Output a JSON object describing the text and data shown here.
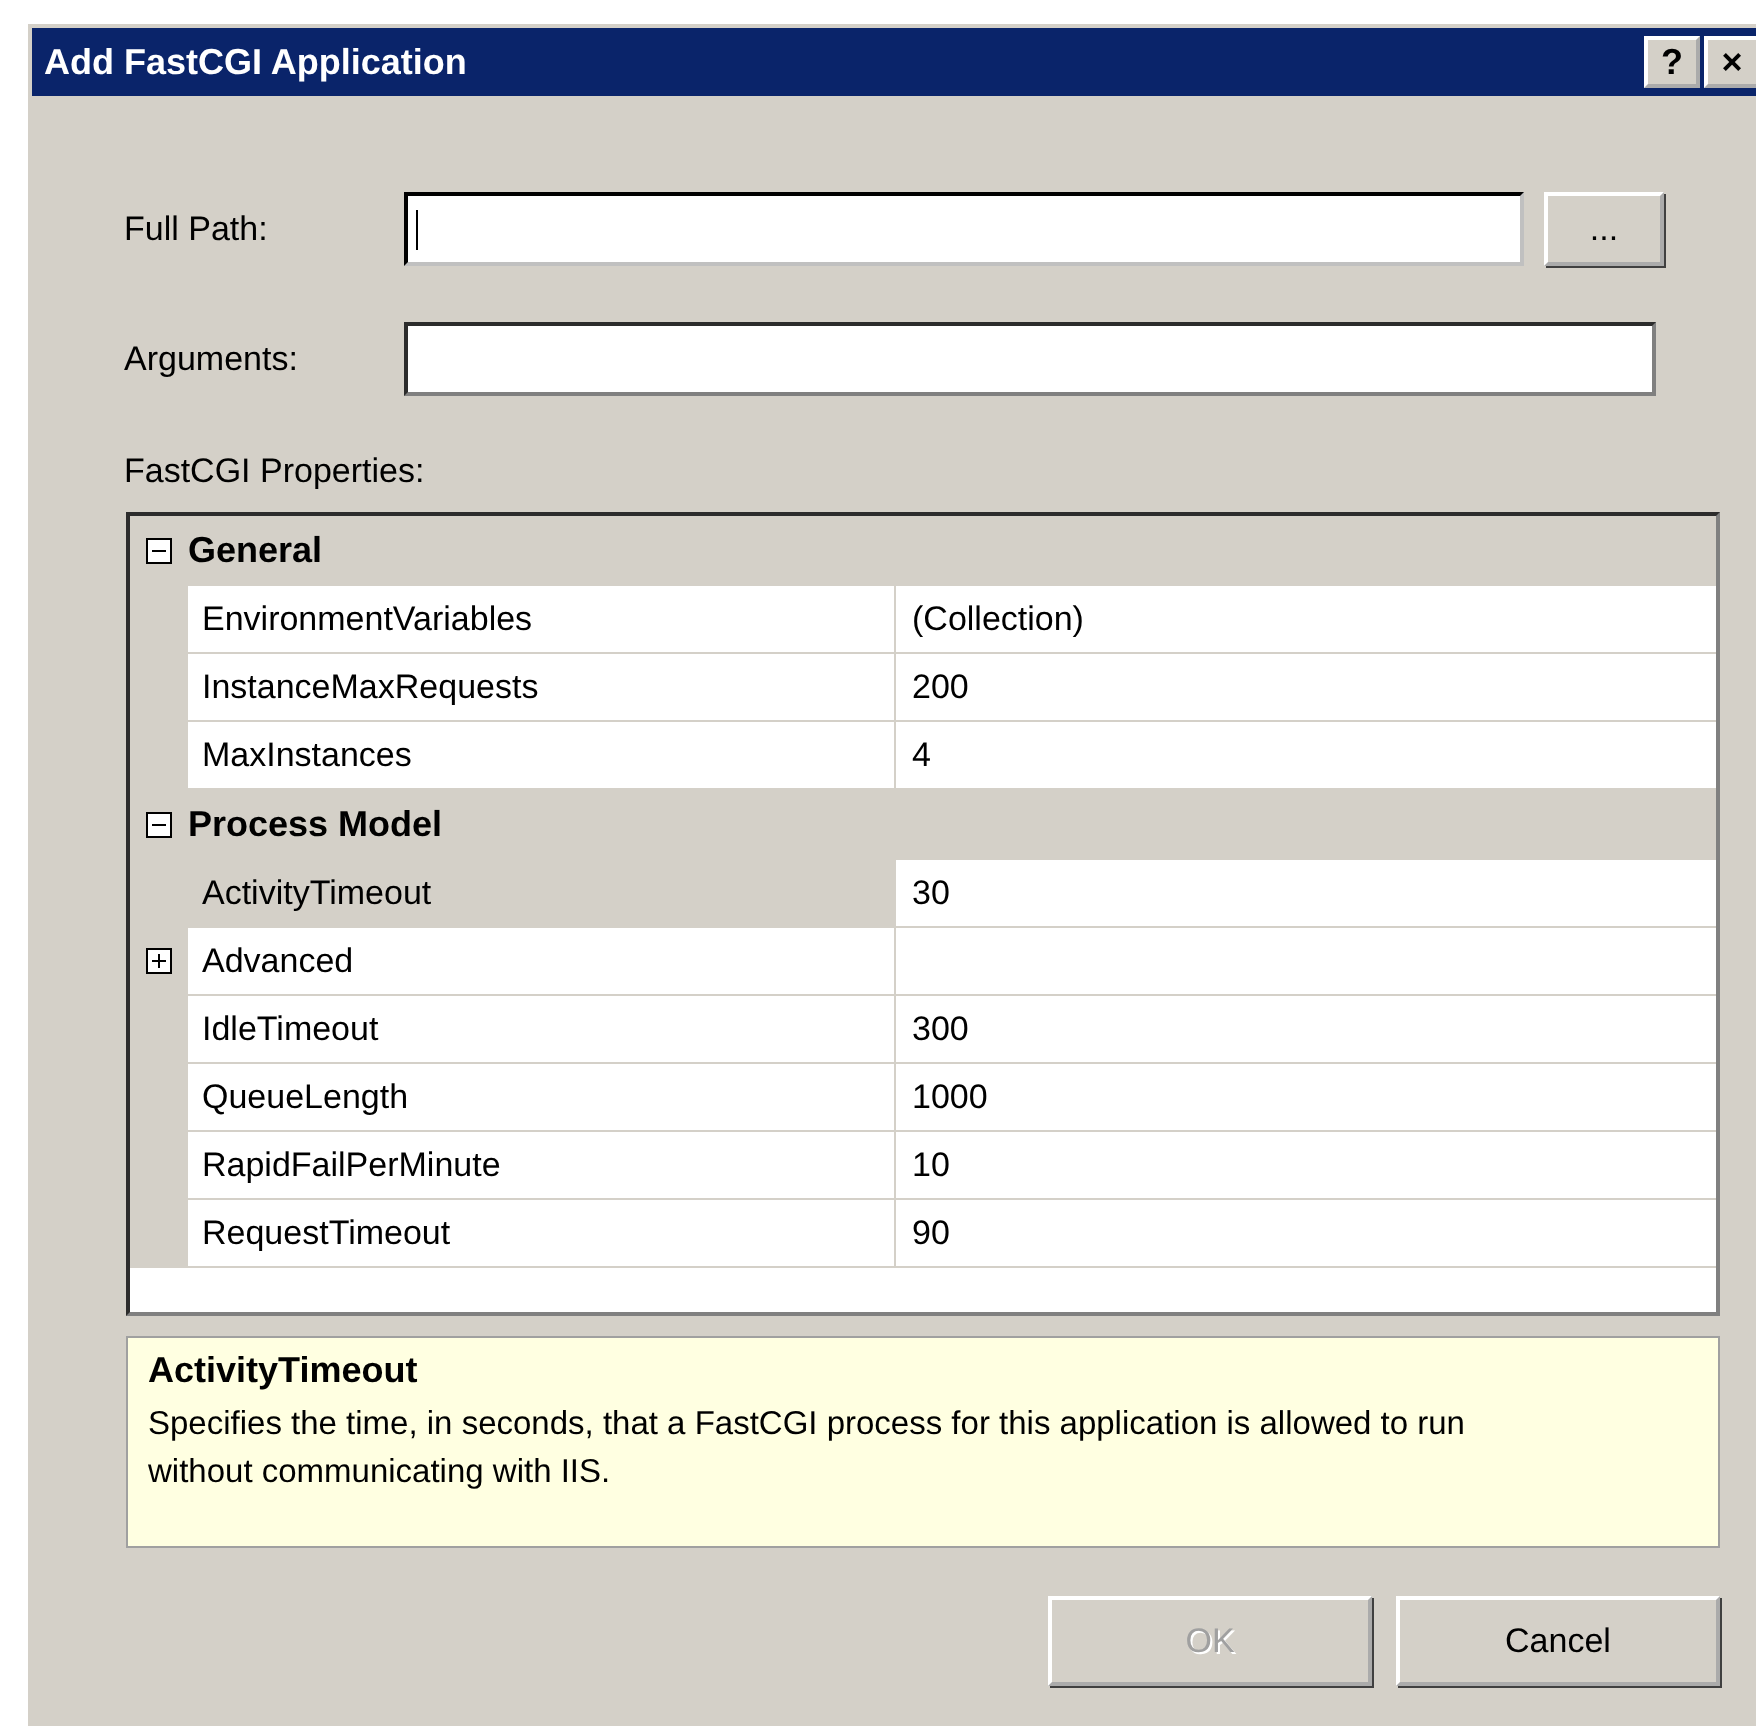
{
  "window": {
    "title": "Add FastCGI Application",
    "buttons": [
      "?",
      "×"
    ]
  },
  "fields": [
    {
      "label": "Full Path:",
      "focused": true,
      "browse": "..."
    },
    {
      "label": "Arguments:",
      "focused": false
    }
  ],
  "properties": {
    "label": "FastCGI Properties:",
    "categories": [
      {
        "name": "General",
        "expanded": true,
        "items": [
          {
            "name": "EnvironmentVariables",
            "value": "(Collection)",
            "selected": false,
            "expandable": false
          },
          {
            "name": "InstanceMaxRequests",
            "value": "200",
            "selected": false,
            "expandable": false
          },
          {
            "name": "MaxInstances",
            "value": "4",
            "selected": false,
            "expandable": false
          }
        ]
      },
      {
        "name": "Process Model",
        "expanded": true,
        "items": [
          {
            "name": "ActivityTimeout",
            "value": "30",
            "selected": true,
            "expandable": false
          },
          {
            "name": "Advanced",
            "selected": false,
            "expandable": true,
            "expanded": false
          },
          {
            "name": "IdleTimeout",
            "value": "300",
            "selected": false,
            "expandable": false
          },
          {
            "name": "QueueLength",
            "value": "1000",
            "selected": false,
            "expandable": false
          },
          {
            "name": "RapidFailPerMinute",
            "value": "10",
            "selected": false,
            "expandable": false
          },
          {
            "name": "RequestTimeout",
            "value": "90",
            "selected": false,
            "expandable": false
          }
        ]
      }
    ]
  },
  "description": {
    "title": "ActivityTimeout",
    "text": "Specifies the time, in seconds, that a FastCGI process for this application is allowed to run without communicating with IIS."
  },
  "buttons": [
    {
      "label": "OK",
      "disabled": true
    },
    {
      "label": "Cancel",
      "disabled": false
    }
  ]
}
